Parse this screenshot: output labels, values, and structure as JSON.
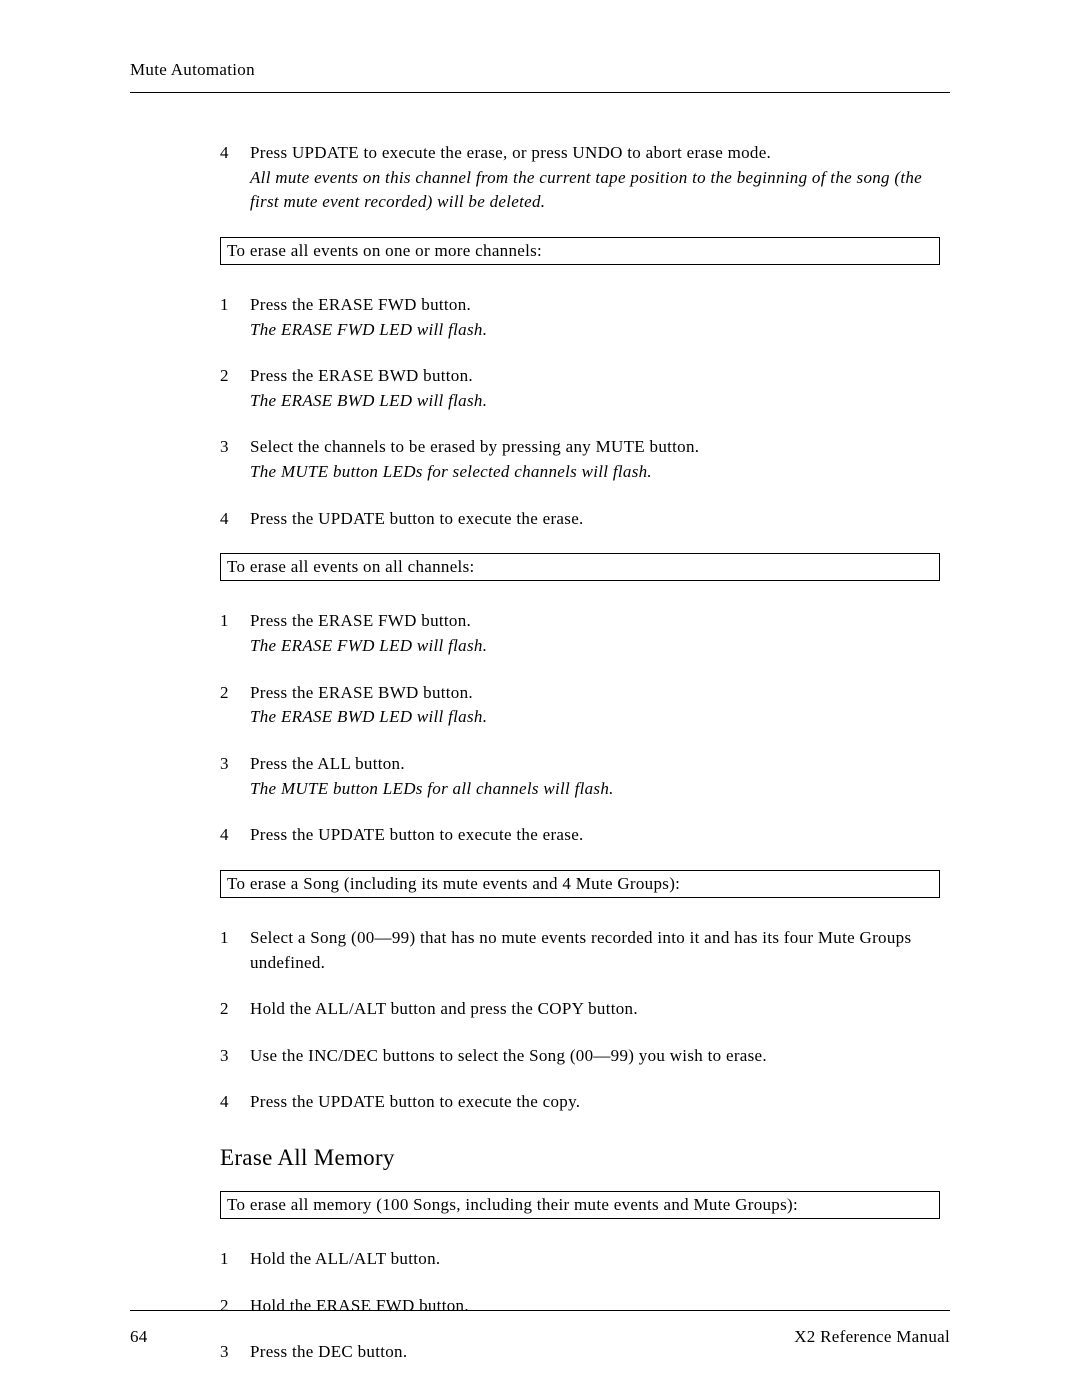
{
  "header": "Mute Automation",
  "introStep": {
    "num": "4",
    "line1": "Press UPDATE to execute the erase, or press UNDO to abort erase mode.",
    "line2": "All mute events on this channel from the current tape position to the beginning of the song (the first mute event recorded) will be deleted."
  },
  "box1": "To erase all events on one or more channels:",
  "steps1": [
    {
      "num": "1",
      "line1": "Press the ERASE FWD button.",
      "line2": "The ERASE FWD LED will flash."
    },
    {
      "num": "2",
      "line1": "Press the ERASE BWD button.",
      "line2": "The ERASE BWD LED will flash."
    },
    {
      "num": "3",
      "line1": "Select the channels to be erased by pressing any MUTE button.",
      "line2": "The MUTE button LEDs for selected channels will flash."
    },
    {
      "num": "4",
      "line1": "Press the UPDATE button to execute the erase.",
      "line2": ""
    }
  ],
  "box2": "To erase all events on all channels:",
  "steps2": [
    {
      "num": "1",
      "line1": "Press the ERASE FWD button.",
      "line2": "The ERASE FWD LED will flash."
    },
    {
      "num": "2",
      "line1": "Press the ERASE BWD button.",
      "line2": "The ERASE BWD LED will flash."
    },
    {
      "num": "3",
      "line1": "Press the ALL button.",
      "line2": "The MUTE button LEDs for all channels will flash."
    },
    {
      "num": "4",
      "line1": "Press the UPDATE button to execute the erase.",
      "line2": ""
    }
  ],
  "box3": "To erase a Song (including its mute events and 4 Mute Groups):",
  "steps3": [
    {
      "num": "1",
      "line1": "Select a Song (00—99) that has no mute events recorded into it and has its four Mute Groups undefined.",
      "line2": ""
    },
    {
      "num": "2",
      "line1": "Hold the ALL/ALT button and press the COPY button.",
      "line2": ""
    },
    {
      "num": "3",
      "line1": "Use the INC/DEC buttons to select the Song (00—99) you wish to erase.",
      "line2": ""
    },
    {
      "num": "4",
      "line1": "Press the UPDATE button to execute the copy.",
      "line2": ""
    }
  ],
  "sectionHeading": "Erase All Memory",
  "box4": "To erase all memory (100 Songs, including their mute events and Mute Groups):",
  "steps4": [
    {
      "num": "1",
      "line1": "Hold the ALL/ALT button.",
      "line2": ""
    },
    {
      "num": "2",
      "line1": "Hold the ERASE FWD button.",
      "line2": ""
    },
    {
      "num": "3",
      "line1": "Press the DEC button.",
      "line2": ""
    }
  ],
  "footer": {
    "pageNum": "64",
    "title": "X2 Reference Manual"
  }
}
